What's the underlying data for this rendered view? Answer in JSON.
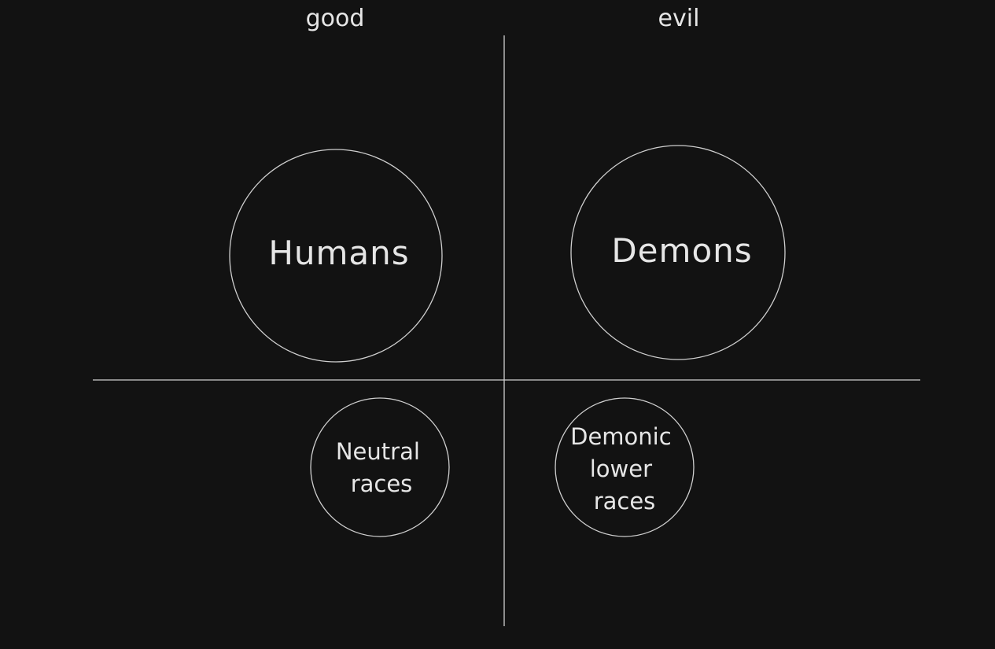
{
  "colors": {
    "background": "#121212",
    "stroke": "#cfcfcf",
    "text": "#e6e6e6"
  },
  "headers": {
    "left": "good",
    "right": "evil"
  },
  "nodes": {
    "humans": {
      "lines": [
        "Humans"
      ]
    },
    "demons": {
      "lines": [
        "Demons"
      ]
    },
    "neutral": {
      "lines": [
        "Neutral",
        "races"
      ]
    },
    "demonic": {
      "lines": [
        "Demonic",
        "lower",
        "races"
      ]
    }
  }
}
